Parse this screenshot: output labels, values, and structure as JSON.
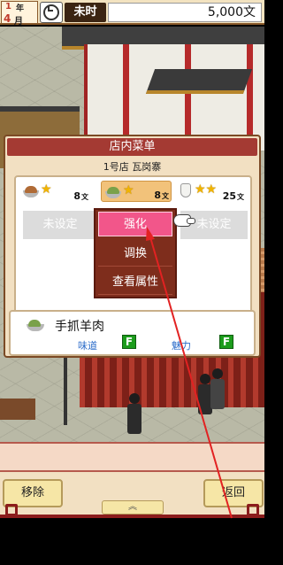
{
  "status_bar": {
    "year_num": "1",
    "year_unit": "年",
    "month_num": "4",
    "month_unit": "月",
    "time_of_day": "未时",
    "money": "5,000文"
  },
  "dialog": {
    "title": "店内菜单",
    "shop_name": "1号店 瓦岗寨",
    "slots": [
      {
        "icon": "meat-bun-dish-icon",
        "stars": "★",
        "price": "8",
        "unit": "文"
      },
      {
        "icon": "lamb-dish-icon",
        "stars": "★",
        "price": "8",
        "unit": "文"
      },
      {
        "icon": "wine-bag-icon",
        "stars": "★★",
        "price": "25",
        "unit": "文"
      }
    ],
    "unset_left": "未设定",
    "unset_right": "未设定",
    "popup_menu": [
      "强化",
      "调换",
      "查看属性"
    ],
    "selected_dish": {
      "name": "手抓羊肉",
      "attr1_label": "味道",
      "attr1_grade": "F",
      "attr2_label": "魅力",
      "attr2_grade": "F"
    }
  },
  "bottom": {
    "remove_label": "移除",
    "back_label": "返回",
    "scroll_tab_label": "︽"
  },
  "colors": {
    "title_red": "#a43a33",
    "highlight_pink": "#f2568a",
    "popup_brown": "#7e2d1c",
    "grade_green": "#1c9c1c",
    "attr_blue": "#2a6bc9",
    "annotation_red": "#e22222"
  }
}
